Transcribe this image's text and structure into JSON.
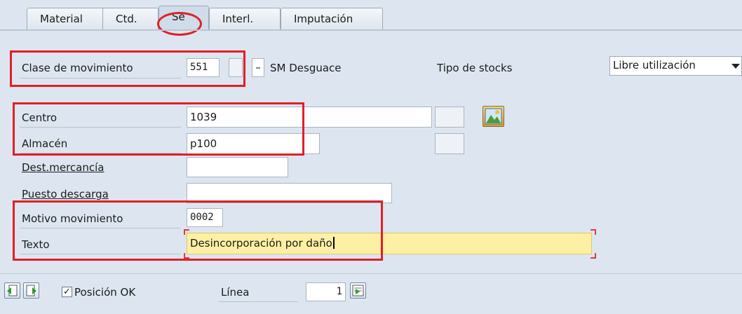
{
  "tabs": [
    {
      "label": "Material"
    },
    {
      "label": "Ctd."
    },
    {
      "label": "Se"
    },
    {
      "label": "Interl."
    },
    {
      "label": "Imputación"
    }
  ],
  "movement": {
    "label": "Clase de movimiento",
    "value": "551",
    "special_value": "",
    "dash": "–",
    "description": "SM Desguace"
  },
  "stock_type": {
    "label": "Tipo de stocks",
    "selected": "Libre utilización"
  },
  "fields": {
    "centro": {
      "label": "Centro",
      "value": "1039"
    },
    "almacen": {
      "label": "Almacén",
      "value": "p100"
    },
    "dest_mercancia": {
      "label": "Dest.mercancía",
      "value": ""
    },
    "puesto_descarga": {
      "label": "Puesto descarga",
      "value": ""
    },
    "motivo_movimiento": {
      "label": "Motivo movimiento",
      "value": "0002"
    },
    "texto": {
      "label": "Texto",
      "value": "Desincorporación por daño"
    }
  },
  "footer": {
    "checkbox_mark": "✓",
    "posicion_ok_label": "Posición OK",
    "linea_label": "Línea",
    "linea_value": "1"
  },
  "colors": {
    "highlight_red": "#e21e26",
    "background": "#dde6f0",
    "text_field_yellow": "#fdf0a4"
  }
}
